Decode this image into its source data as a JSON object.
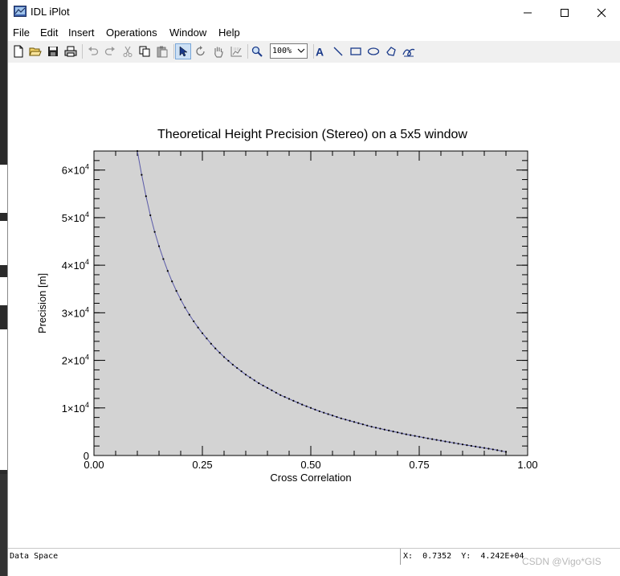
{
  "window": {
    "title": "IDL iPlot"
  },
  "menu": {
    "items": [
      "File",
      "Edit",
      "Insert",
      "Operations",
      "Window",
      "Help"
    ]
  },
  "toolbar": {
    "zoom_value": "100%",
    "icons": [
      "new-file-icon",
      "open-folder-icon",
      "save-icon",
      "print-icon",
      "undo-icon",
      "redo-icon",
      "cut-icon",
      "copy-icon",
      "paste-icon",
      "select-arrow-icon",
      "rotate-icon",
      "pan-hand-icon",
      "data-range-icon",
      "zoom-icon",
      "text-tool-icon",
      "line-tool-icon",
      "rectangle-tool-icon",
      "oval-tool-icon",
      "polygon-tool-icon",
      "freehand-tool-icon"
    ]
  },
  "status": {
    "left": "Data Space",
    "coords": "X:  0.7352  Y:  4.242E+04"
  },
  "watermark": "CSDN @Vigo*GIS",
  "chart_data": {
    "type": "line",
    "title": "Theoretical Height Precision (Stereo) on a 5x5 window",
    "xlabel": "Cross Correlation",
    "ylabel": "Precision [m]",
    "xlim": [
      0.0,
      1.0
    ],
    "ylim": [
      0,
      64000
    ],
    "x_ticks": [
      "0.00",
      "0.25",
      "0.50",
      "0.75",
      "1.00"
    ],
    "y_ticks": [
      {
        "mant": "0",
        "exp": ""
      },
      {
        "mant": "1×10",
        "exp": "4"
      },
      {
        "mant": "2×10",
        "exp": "4"
      },
      {
        "mant": "3×10",
        "exp": "4"
      },
      {
        "mant": "4×10",
        "exp": "4"
      },
      {
        "mant": "5×10",
        "exp": "4"
      },
      {
        "mant": "6×10",
        "exp": "4"
      }
    ],
    "background": "#d3d3d3",
    "line_color": "#5a5aa8",
    "marker_color": "#000000",
    "series": [
      {
        "x": [
          0.1,
          0.11,
          0.12,
          0.13,
          0.14,
          0.15,
          0.16,
          0.17,
          0.18,
          0.19,
          0.2,
          0.21,
          0.22,
          0.23,
          0.24,
          0.25,
          0.26,
          0.27,
          0.28,
          0.29,
          0.3,
          0.31,
          0.32,
          0.33,
          0.34,
          0.35,
          0.36,
          0.37,
          0.38,
          0.39,
          0.4,
          0.41,
          0.42,
          0.43,
          0.44,
          0.45,
          0.46,
          0.47,
          0.48,
          0.49,
          0.5,
          0.51,
          0.52,
          0.53,
          0.54,
          0.55,
          0.56,
          0.57,
          0.58,
          0.59,
          0.6,
          0.61,
          0.62,
          0.63,
          0.64,
          0.65,
          0.66,
          0.67,
          0.68,
          0.69,
          0.7,
          0.71,
          0.72,
          0.73,
          0.74,
          0.75,
          0.76,
          0.77,
          0.78,
          0.79,
          0.8,
          0.81,
          0.82,
          0.83,
          0.84,
          0.85,
          0.86,
          0.87,
          0.88,
          0.89,
          0.9,
          0.91,
          0.92,
          0.93,
          0.94,
          0.95
        ],
        "y": [
          64000,
          59000,
          54500,
          50500,
          47000,
          44000,
          41300,
          38800,
          36600,
          34600,
          32800,
          31100,
          29600,
          28200,
          26900,
          25700,
          24600,
          23500,
          22500,
          21600,
          20700,
          19900,
          19100,
          18400,
          17700,
          17000,
          16400,
          15800,
          15200,
          14700,
          14200,
          13700,
          13200,
          12700,
          12300,
          11900,
          11500,
          11100,
          10700,
          10350,
          10000,
          9650,
          9300,
          9000,
          8700,
          8400,
          8100,
          7800,
          7550,
          7300,
          7050,
          6800,
          6550,
          6300,
          6050,
          5850,
          5650,
          5450,
          5250,
          5050,
          4850,
          4650,
          4450,
          4280,
          4110,
          3940,
          3770,
          3600,
          3440,
          3280,
          3120,
          2960,
          2800,
          2640,
          2480,
          2330,
          2180,
          2030,
          1880,
          1730,
          1580,
          1430,
          1280,
          1120,
          940,
          760
        ]
      }
    ]
  }
}
